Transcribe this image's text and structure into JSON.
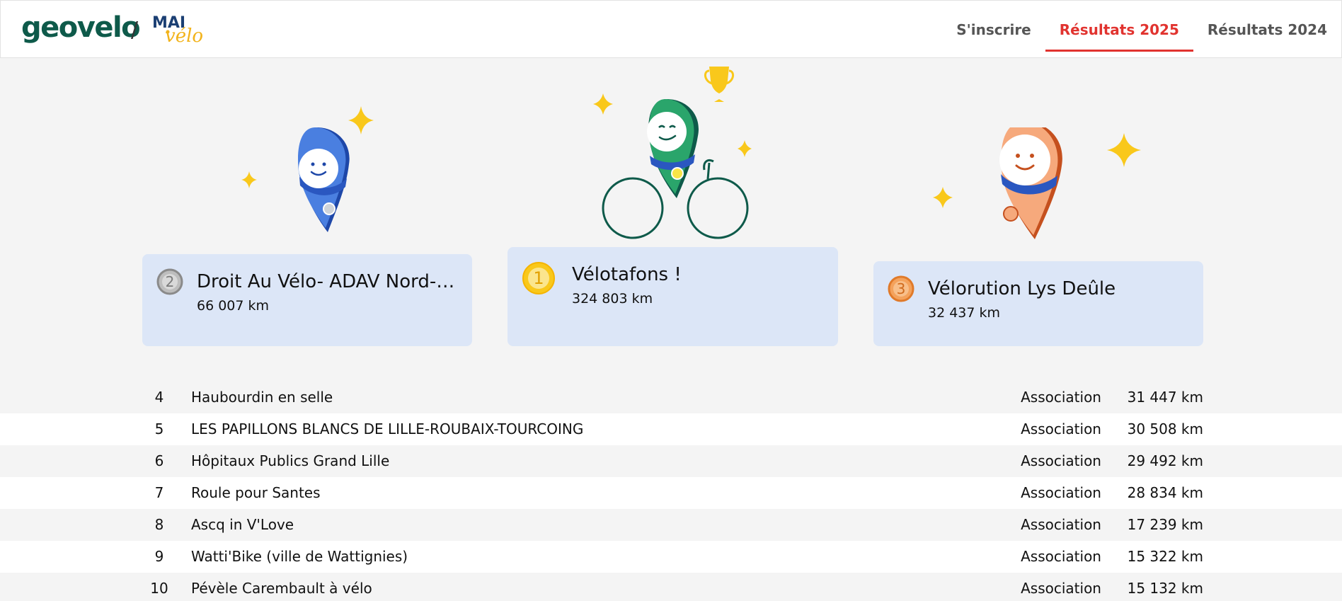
{
  "header": {
    "logo_text": "geovelo",
    "separator": "/",
    "partner_logo": {
      "top": "MAI",
      "bottom": "vélo"
    },
    "nav": [
      {
        "label": "S'inscrire",
        "active": false
      },
      {
        "label": "Résultats 2025",
        "active": true
      },
      {
        "label": "Résultats 2024",
        "active": false
      }
    ]
  },
  "colors": {
    "brand_green": "#0e5a4a",
    "accent_red": "#e1332f",
    "card_bg": "#dce6f7",
    "pin_blue": "#4a7fe0",
    "pin_green": "#2aa56b",
    "pin_orange": "#f6a97c",
    "star_yellow": "#f9c81b"
  },
  "podium": [
    {
      "rank": "2",
      "name": "Droit Au Vélo- ADAV Nord-Pa...",
      "distance": "66 007 km",
      "medal": "silver"
    },
    {
      "rank": "1",
      "name": "Vélotafons !",
      "distance": "324 803 km",
      "medal": "gold"
    },
    {
      "rank": "3",
      "name": "Vélorution Lys Deûle",
      "distance": "32 437 km",
      "medal": "bronze"
    }
  ],
  "rankings": [
    {
      "rank": "4",
      "name": "Haubourdin en selle",
      "type": "Association",
      "distance": "31 447 km"
    },
    {
      "rank": "5",
      "name": "LES PAPILLONS BLANCS DE LILLE-ROUBAIX-TOURCOING",
      "type": "Association",
      "distance": "30 508 km"
    },
    {
      "rank": "6",
      "name": "Hôpitaux Publics Grand Lille",
      "type": "Association",
      "distance": "29 492 km"
    },
    {
      "rank": "7",
      "name": "Roule pour Santes",
      "type": "Association",
      "distance": "28 834 km"
    },
    {
      "rank": "8",
      "name": "Ascq in V'Love",
      "type": "Association",
      "distance": "17 239 km"
    },
    {
      "rank": "9",
      "name": "Watti'Bike (ville de Wattignies)",
      "type": "Association",
      "distance": "15 322 km"
    },
    {
      "rank": "10",
      "name": "Pévèle Carembault à vélo",
      "type": "Association",
      "distance": "15 132 km"
    }
  ]
}
